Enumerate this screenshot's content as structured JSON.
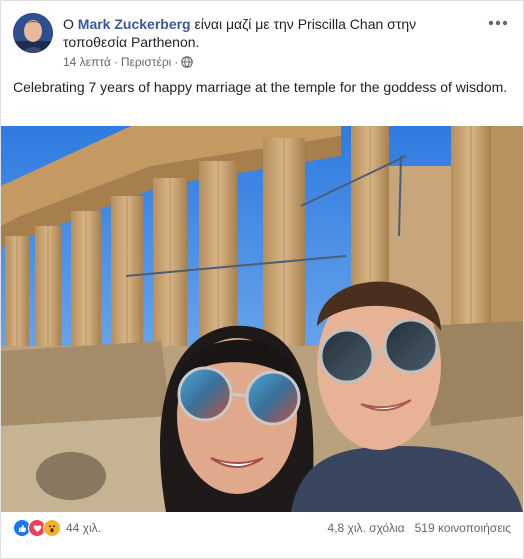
{
  "post": {
    "prefix": "Ο",
    "author": "Mark Zuckerberg",
    "with_text": "είναι μαζί με την",
    "tagged": "Priscilla Chan",
    "at_text": "στην τοποθεσία",
    "place": "Parthenon.",
    "time": "14 λεπτά",
    "location": "Περιστέρι",
    "separator": "·",
    "privacy_icon": "globe-icon",
    "more_icon": "more-dots-icon",
    "text": "Celebrating 7 years of happy marriage at the temple for the goddess of wisdom."
  },
  "footer": {
    "reactions_count": "44 χιλ.",
    "reaction_icons": [
      "like-icon",
      "love-icon",
      "wow-icon"
    ],
    "comments": "4,8 χιλ. σχόλια",
    "shares": "519 κοινοποιήσεις"
  },
  "colors": {
    "link": "#385898",
    "like": "#1877f2",
    "love": "#f33e58",
    "wow": "#f7b125"
  }
}
